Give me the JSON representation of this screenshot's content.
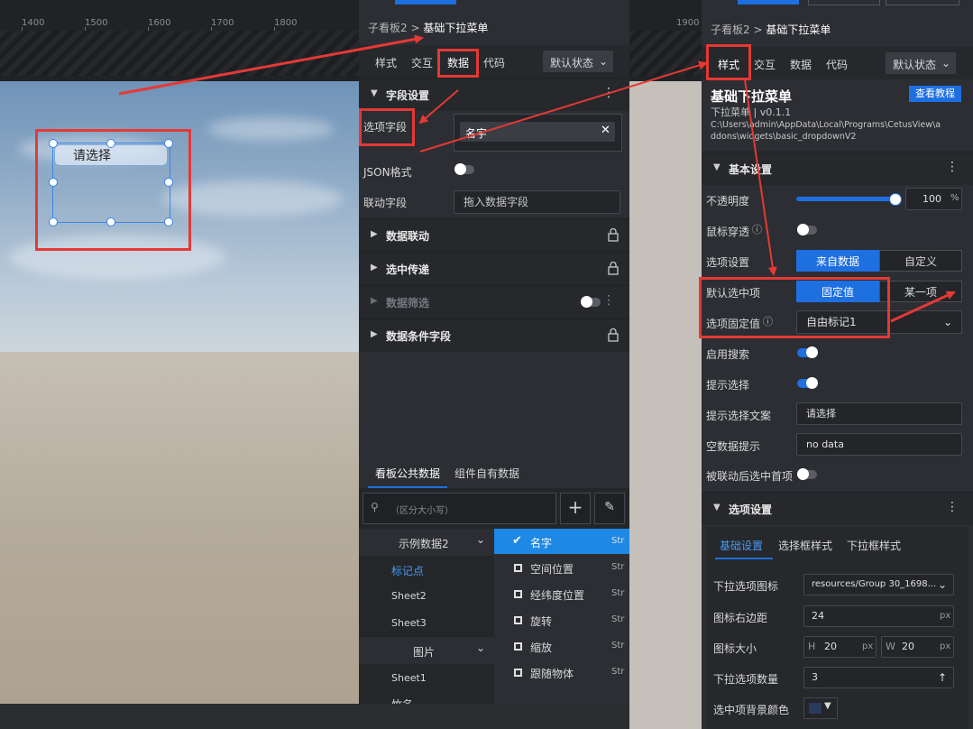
{
  "canvas": {
    "ruler_ticks": [
      "1400",
      "1500",
      "1600",
      "1700",
      "1800"
    ],
    "preview_placeholder": "请选择"
  },
  "gap_ruler_tick": "1900",
  "mid": {
    "breadcrumb_parent": "子看板2",
    "breadcrumb_sep": ">",
    "breadcrumb_current": "基础下拉菜单",
    "tabs": [
      "样式",
      "交互",
      "数据",
      "代码"
    ],
    "state_select": "默认状态",
    "section_field": "字段设置",
    "option_field_label": "选项字段",
    "option_field_value": "名字",
    "json_label": "JSON格式",
    "link_field_label": "联动字段",
    "link_field_placeholder": "拖入数据字段",
    "sections": [
      "数据联动",
      "选中传递",
      "数据筛选",
      "数据条件字段"
    ],
    "data_tabs": [
      "看板公共数据",
      "组件自有数据"
    ],
    "search_placeholder": "（区分大小写）",
    "sources": [
      "示例数据2",
      "标记点",
      "Sheet2",
      "Sheet3",
      "图片",
      "Sheet1",
      "竹名"
    ],
    "fields": [
      {
        "label": "名字",
        "type": "Str",
        "checked": true
      },
      {
        "label": "空间位置",
        "type": "Str",
        "checked": false
      },
      {
        "label": "经纬度位置",
        "type": "Str",
        "checked": false
      },
      {
        "label": "旋转",
        "type": "Str",
        "checked": false
      },
      {
        "label": "缩放",
        "type": "Str",
        "checked": false
      },
      {
        "label": "跟随物体",
        "type": "Str",
        "checked": false
      }
    ]
  },
  "right": {
    "breadcrumb_parent": "子看板2",
    "breadcrumb_sep": ">",
    "breadcrumb_current": "基础下拉菜单",
    "tabs": [
      "样式",
      "交互",
      "数据",
      "代码"
    ],
    "state_select": "默认状态",
    "component_title": "基础下拉菜单",
    "tutorial_button": "查看教程",
    "component_version": "下拉菜单 | v0.1.1",
    "component_path_1": "C:\\Users\\admin\\AppData\\Local\\Programs\\CetusView\\a",
    "component_path_2": "ddons\\widgets\\basic_dropdownV2",
    "section_basic": "基本设置",
    "opacity_label": "不透明度",
    "opacity_value": "100",
    "opacity_unit": "%",
    "opacity_fraction": 1.0,
    "mouse_through_label": "鼠标穿透",
    "option_setting_label": "选项设置",
    "option_setting_opts": [
      "来自数据",
      "自定义"
    ],
    "default_selected_label": "默认选中项",
    "default_selected_opts": [
      "固定值",
      "某一项"
    ],
    "fixed_value_label": "选项固定值",
    "fixed_value": "自由标记1",
    "enable_search_label": "启用搜索",
    "prompt_select_label": "提示选择",
    "prompt_text_label": "提示选择文案",
    "prompt_text_value": "请选择",
    "empty_label": "空数据提示",
    "empty_value": "no data",
    "select_first_label": "被联动后选中首项",
    "section_options": "选项设置",
    "option_tabs": [
      "基础设置",
      "选择框样式",
      "下拉框样式"
    ],
    "icon_label": "下拉选项图标",
    "icon_value": "resources/Group 30_1698...",
    "icon_margin_label": "图标右边距",
    "icon_margin_value": "24",
    "px": "px",
    "icon_size_label": "图标大小",
    "h": "H",
    "w": "W",
    "icon_h": "20",
    "icon_w": "20",
    "count_label": "下拉选项数量",
    "count_value": "3",
    "bg_color_label": "选中项背景颜色"
  },
  "colors": {
    "accent": "#1e6fe0",
    "highlight": "#e53935",
    "selected_row": "#1e88e5"
  }
}
